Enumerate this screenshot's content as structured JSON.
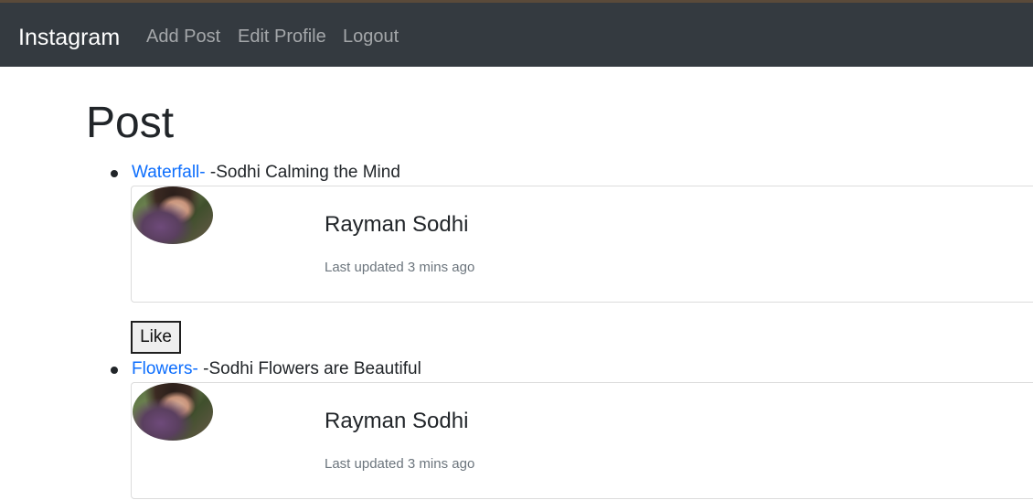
{
  "navbar": {
    "brand": "Instagram",
    "links": [
      "Add Post",
      "Edit Profile",
      "Logout"
    ]
  },
  "page": {
    "title": "Post"
  },
  "posts": [
    {
      "link_text": "Waterfall-",
      "text": " -Sodhi Calming the Mind",
      "card": {
        "avatar_icon": "profile-photo",
        "name": "Rayman Sodhi",
        "meta": "Last updated 3 mins ago"
      },
      "like_label": "Like"
    },
    {
      "link_text": "Flowers-",
      "text": " -Sodhi Flowers are Beautiful",
      "card": {
        "avatar_icon": "profile-photo",
        "name": "Rayman Sodhi",
        "meta": "Last updated 3 mins ago"
      }
    }
  ],
  "colors": {
    "navbar_bg": "#343a40",
    "link": "#0d6efd",
    "muted_text": "#6c757d"
  }
}
